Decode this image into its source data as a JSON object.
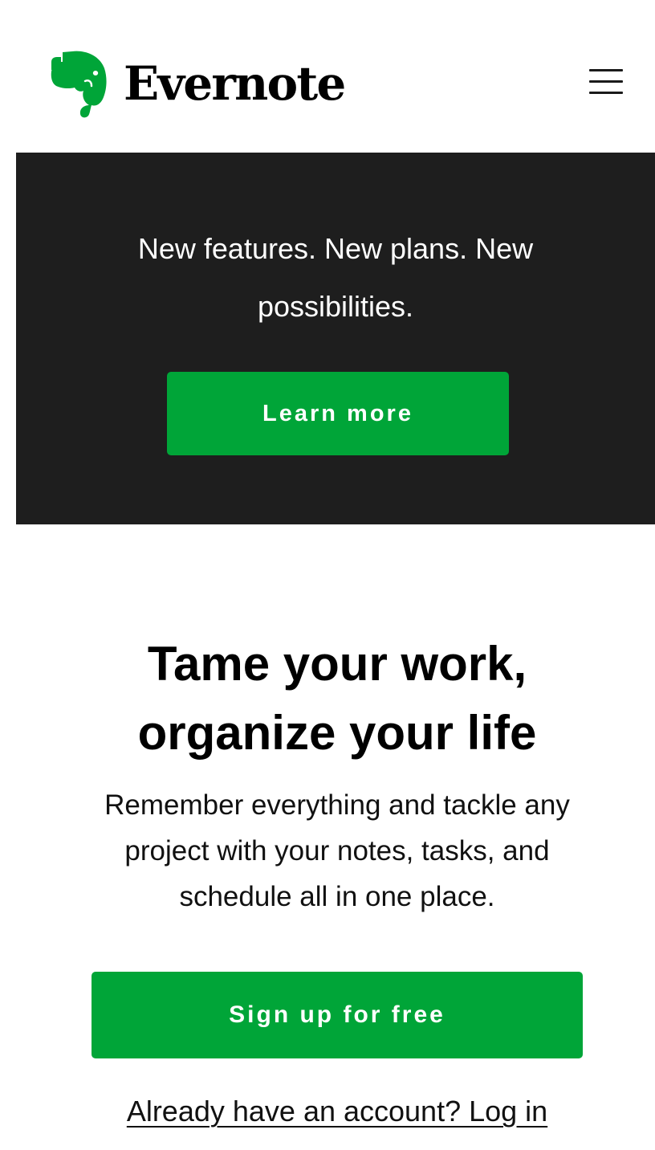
{
  "brand": {
    "name": "Evernote",
    "color": "#00a538"
  },
  "header": {
    "menu_icon": "hamburger-menu-icon"
  },
  "banner": {
    "text": "New features. New plans. New possibilities.",
    "button_label": "Learn more",
    "background": "#1e1e1e"
  },
  "hero": {
    "title": "Tame your work, organize your life",
    "subtitle": "Remember everything and tackle any project with your notes, tasks, and schedule all in one place.",
    "signup_label": "Sign up for free",
    "login_link": "Already have an account? Log in"
  }
}
